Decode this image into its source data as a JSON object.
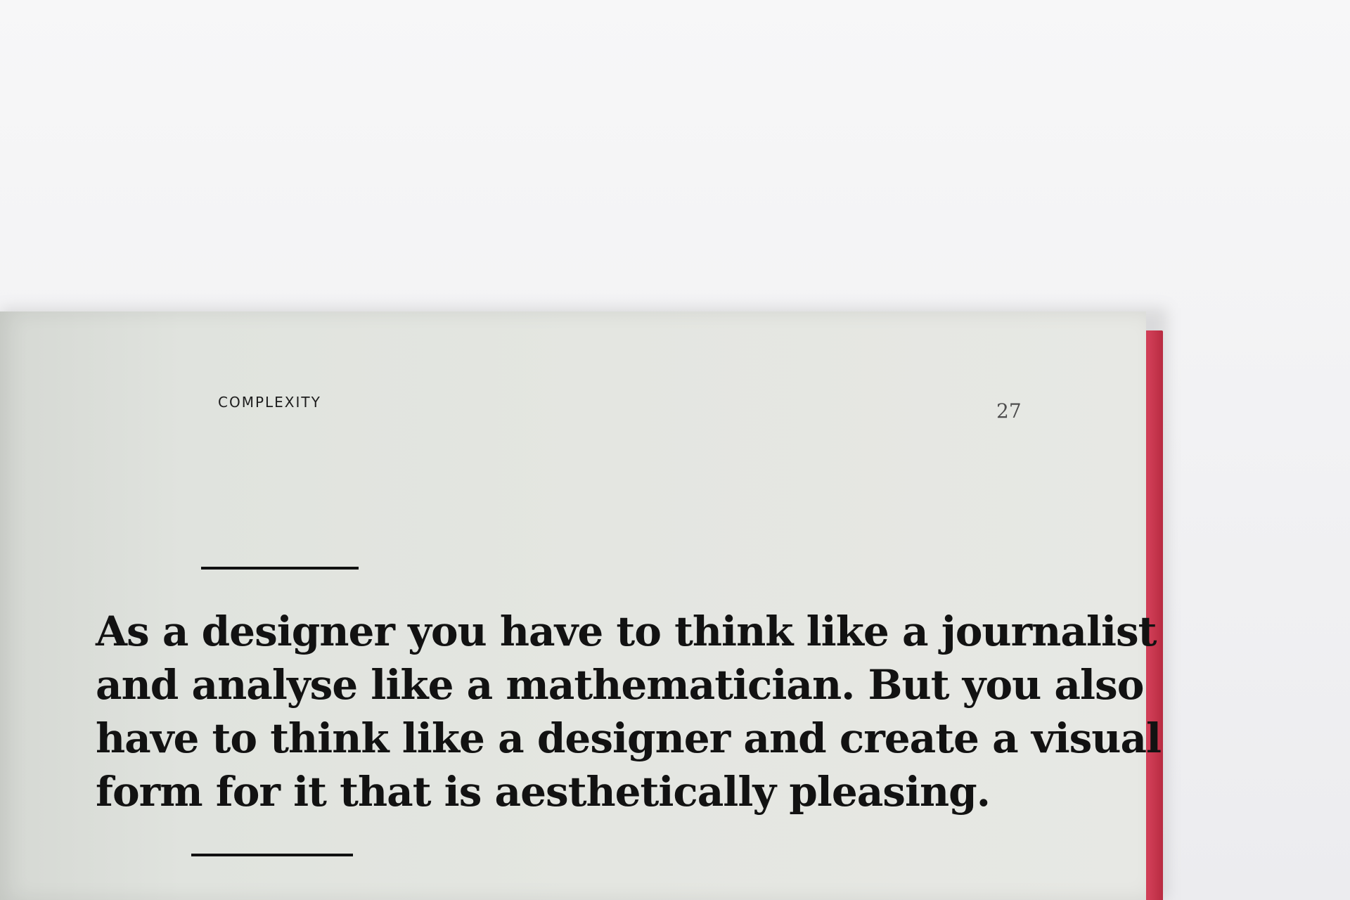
{
  "page": {
    "running_header": "COMPLEXITY",
    "number": "27",
    "quote_lines": [
      "As a designer you have to think like a journalist",
      "and analyse like a mathematician. But you also",
      "have to think like a designer and create a visual",
      "form for it that is aesthetically pleasing."
    ]
  }
}
